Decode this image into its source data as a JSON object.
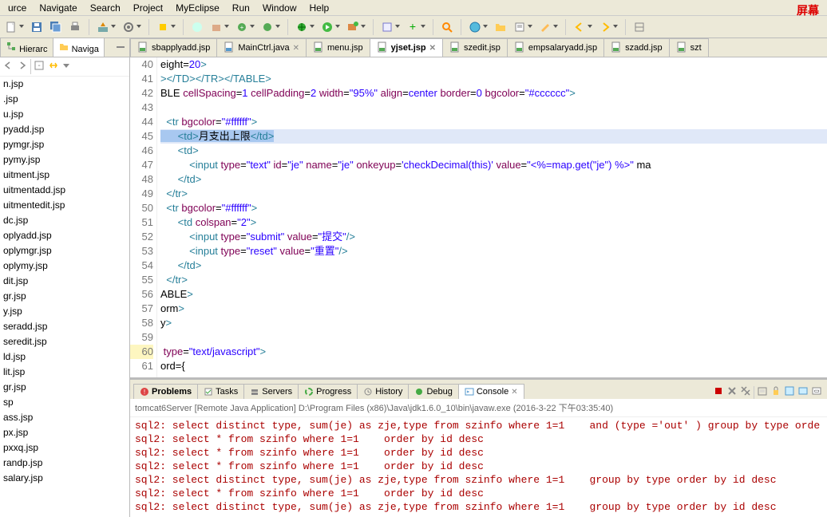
{
  "topbar_red": "屏幕",
  "menu": [
    "urce",
    "Navigate",
    "Search",
    "Project",
    "MyEclipse",
    "Run",
    "Window",
    "Help"
  ],
  "side_tabs": [
    "Hierarc",
    "Naviga"
  ],
  "side_files": [
    "n.jsp",
    ".jsp",
    "u.jsp",
    "pyadd.jsp",
    "pymgr.jsp",
    "pymy.jsp",
    "uitment.jsp",
    "uitmentadd.jsp",
    "uitmentedit.jsp",
    "dc.jsp",
    "oplyadd.jsp",
    "oplymgr.jsp",
    "oplymy.jsp",
    "dit.jsp",
    "gr.jsp",
    "y.jsp",
    "seradd.jsp",
    "seredit.jsp",
    "ld.jsp",
    "lit.jsp",
    "gr.jsp",
    "sp",
    "ass.jsp",
    "px.jsp",
    "pxxq.jsp",
    "randp.jsp",
    "salary.jsp"
  ],
  "editor_tabs": [
    {
      "label": "sbapplyadd.jsp",
      "active": false
    },
    {
      "label": "MainCtrl.java",
      "active": false,
      "close": true
    },
    {
      "label": "menu.jsp",
      "active": false
    },
    {
      "label": "yjset.jsp",
      "active": true,
      "close": true
    },
    {
      "label": "szedit.jsp",
      "active": false
    },
    {
      "label": "empsalaryadd.jsp",
      "active": false
    },
    {
      "label": "szadd.jsp",
      "active": false
    },
    {
      "label": "szt",
      "active": false
    }
  ],
  "code": {
    "start": 40,
    "lines": [
      {
        "n": 40,
        "raw": "eight=20>",
        "seg": [
          [
            "txt",
            "eight="
          ],
          [
            "str",
            "20"
          ],
          [
            "tag",
            ">"
          ]
        ]
      },
      {
        "n": 41,
        "raw": "></TD></TR></TABLE>",
        "seg": [
          [
            "tag",
            "></TD></TR></TABLE>"
          ]
        ]
      },
      {
        "n": 42,
        "raw": "BLE cellSpacing=1 cellPadding=2 width=\"95%\" align=center border=0 bgcolor=\"#cccccc\">",
        "seg": [
          [
            "txt",
            "BLE "
          ],
          [
            "attr",
            "cellSpacing"
          ],
          [
            "txt",
            "="
          ],
          [
            "str",
            "1"
          ],
          [
            "txt",
            " "
          ],
          [
            "attr",
            "cellPadding"
          ],
          [
            "txt",
            "="
          ],
          [
            "str",
            "2"
          ],
          [
            "txt",
            " "
          ],
          [
            "attr",
            "width"
          ],
          [
            "txt",
            "="
          ],
          [
            "str",
            "\"95%\""
          ],
          [
            "txt",
            " "
          ],
          [
            "attr",
            "align"
          ],
          [
            "txt",
            "="
          ],
          [
            "str",
            "center"
          ],
          [
            "txt",
            " "
          ],
          [
            "attr",
            "border"
          ],
          [
            "txt",
            "="
          ],
          [
            "str",
            "0"
          ],
          [
            "txt",
            " "
          ],
          [
            "attr",
            "bgcolor"
          ],
          [
            "txt",
            "="
          ],
          [
            "str",
            "\"#cccccc\""
          ],
          [
            "tag",
            ">"
          ]
        ]
      },
      {
        "n": 43,
        "raw": "",
        "seg": []
      },
      {
        "n": 44,
        "raw": "  <tr bgcolor=\"#ffffff\">",
        "seg": [
          [
            "txt",
            "  "
          ],
          [
            "tag",
            "<tr "
          ],
          [
            "attr",
            "bgcolor"
          ],
          [
            "txt",
            "="
          ],
          [
            "str",
            "\"#ffffff\""
          ],
          [
            "tag",
            ">"
          ]
        ]
      },
      {
        "n": 45,
        "raw": "      <td>月支出上限</td>",
        "hl": true,
        "sel": "      <td>月支出上限</td>",
        "seg": [
          [
            "txt",
            "      "
          ],
          [
            "tag",
            "<td>"
          ],
          [
            "txt",
            "月支出上限"
          ],
          [
            "tag",
            "</td>"
          ]
        ]
      },
      {
        "n": 46,
        "raw": "      <td>",
        "seg": [
          [
            "txt",
            "      "
          ],
          [
            "tag",
            "<td>"
          ]
        ]
      },
      {
        "n": 47,
        "raw": "          <input type=\"text\" id=\"je\" name=\"je\" onkeyup='checkDecimal(this)' value=\"<%=map.get(\"je\") %>\" ma",
        "seg": [
          [
            "txt",
            "          "
          ],
          [
            "tag",
            "<input "
          ],
          [
            "attr",
            "type"
          ],
          [
            "txt",
            "="
          ],
          [
            "str",
            "\"text\""
          ],
          [
            "txt",
            " "
          ],
          [
            "attr",
            "id"
          ],
          [
            "txt",
            "="
          ],
          [
            "str",
            "\"je\""
          ],
          [
            "txt",
            " "
          ],
          [
            "attr",
            "name"
          ],
          [
            "txt",
            "="
          ],
          [
            "str",
            "\"je\""
          ],
          [
            "txt",
            " "
          ],
          [
            "attr",
            "onkeyup"
          ],
          [
            "txt",
            "="
          ],
          [
            "str",
            "'checkDecimal(this)'"
          ],
          [
            "txt",
            " "
          ],
          [
            "attr",
            "value"
          ],
          [
            "txt",
            "="
          ],
          [
            "str",
            "\"<%=map.get(\"je\") %>\""
          ],
          [
            "txt",
            " ma"
          ]
        ]
      },
      {
        "n": 48,
        "raw": "      </td>",
        "seg": [
          [
            "txt",
            "      "
          ],
          [
            "tag",
            "</td>"
          ]
        ]
      },
      {
        "n": 49,
        "raw": "  </tr>",
        "seg": [
          [
            "txt",
            "  "
          ],
          [
            "tag",
            "</tr>"
          ]
        ]
      },
      {
        "n": 50,
        "raw": "  <tr bgcolor=\"#ffffff\">",
        "seg": [
          [
            "txt",
            "  "
          ],
          [
            "tag",
            "<tr "
          ],
          [
            "attr",
            "bgcolor"
          ],
          [
            "txt",
            "="
          ],
          [
            "str",
            "\"#ffffff\""
          ],
          [
            "tag",
            ">"
          ]
        ]
      },
      {
        "n": 51,
        "raw": "      <td colspan=\"2\">",
        "seg": [
          [
            "txt",
            "      "
          ],
          [
            "tag",
            "<td "
          ],
          [
            "attr",
            "colspan"
          ],
          [
            "txt",
            "="
          ],
          [
            "str",
            "\"2\""
          ],
          [
            "tag",
            ">"
          ]
        ]
      },
      {
        "n": 52,
        "raw": "          <input type=\"submit\" value=\"提交\"/>",
        "seg": [
          [
            "txt",
            "          "
          ],
          [
            "tag",
            "<input "
          ],
          [
            "attr",
            "type"
          ],
          [
            "txt",
            "="
          ],
          [
            "str",
            "\"submit\""
          ],
          [
            "txt",
            " "
          ],
          [
            "attr",
            "value"
          ],
          [
            "txt",
            "="
          ],
          [
            "str",
            "\"提交\""
          ],
          [
            "tag",
            "/>"
          ]
        ]
      },
      {
        "n": 53,
        "raw": "          <input type=\"reset\" value=\"重置\"/>",
        "seg": [
          [
            "txt",
            "          "
          ],
          [
            "tag",
            "<input "
          ],
          [
            "attr",
            "type"
          ],
          [
            "txt",
            "="
          ],
          [
            "str",
            "\"reset\""
          ],
          [
            "txt",
            " "
          ],
          [
            "attr",
            "value"
          ],
          [
            "txt",
            "="
          ],
          [
            "str",
            "\"重置\""
          ],
          [
            "tag",
            "/>"
          ]
        ]
      },
      {
        "n": 54,
        "raw": "      </td>",
        "seg": [
          [
            "txt",
            "      "
          ],
          [
            "tag",
            "</td>"
          ]
        ]
      },
      {
        "n": 55,
        "raw": "  </tr>",
        "seg": [
          [
            "txt",
            "  "
          ],
          [
            "tag",
            "</tr>"
          ]
        ]
      },
      {
        "n": 56,
        "raw": "ABLE>",
        "seg": [
          [
            "txt",
            "ABLE"
          ],
          [
            "tag",
            ">"
          ]
        ]
      },
      {
        "n": 57,
        "raw": "orm>",
        "seg": [
          [
            "txt",
            "orm"
          ],
          [
            "tag",
            ">"
          ]
        ]
      },
      {
        "n": 58,
        "raw": "y>",
        "seg": [
          [
            "txt",
            "y"
          ],
          [
            "tag",
            ">"
          ]
        ]
      },
      {
        "n": 59,
        "raw": "",
        "seg": []
      },
      {
        "n": 60,
        "raw": " type=\"text/javascript\">",
        "warn": true,
        "seg": [
          [
            "txt",
            " "
          ],
          [
            "attr",
            "type"
          ],
          [
            "txt",
            "="
          ],
          [
            "str",
            "\"text/javascript\""
          ],
          [
            "tag",
            ">"
          ]
        ]
      },
      {
        "n": 61,
        "raw": "ord={",
        "seg": [
          [
            "txt",
            "ord={"
          ]
        ]
      }
    ]
  },
  "bottom_tabs": [
    {
      "label": "Problems",
      "bold": true
    },
    {
      "label": "Tasks"
    },
    {
      "label": "Servers"
    },
    {
      "label": "Progress"
    },
    {
      "label": "History"
    },
    {
      "label": "Debug"
    },
    {
      "label": "Console",
      "active": true,
      "close": true
    }
  ],
  "console_header": "tomcat6Server [Remote Java Application] D:\\Program Files (x86)\\Java\\jdk1.6.0_10\\bin\\javaw.exe (2016-3-22 下午03:35:40)",
  "console_lines": [
    "sql2: select distinct type, sum(je) as zje,type from szinfo where 1=1    and (type ='out' ) group by type orde",
    "sql2: select * from szinfo where 1=1    order by id desc",
    "sql2: select * from szinfo where 1=1    order by id desc",
    "sql2: select * from szinfo where 1=1    order by id desc",
    "sql2: select distinct type, sum(je) as zje,type from szinfo where 1=1    group by type order by id desc",
    "sql2: select * from szinfo where 1=1    order by id desc",
    "sql2: select distinct type, sum(je) as zje,type from szinfo where 1=1    group by type order by id desc"
  ]
}
